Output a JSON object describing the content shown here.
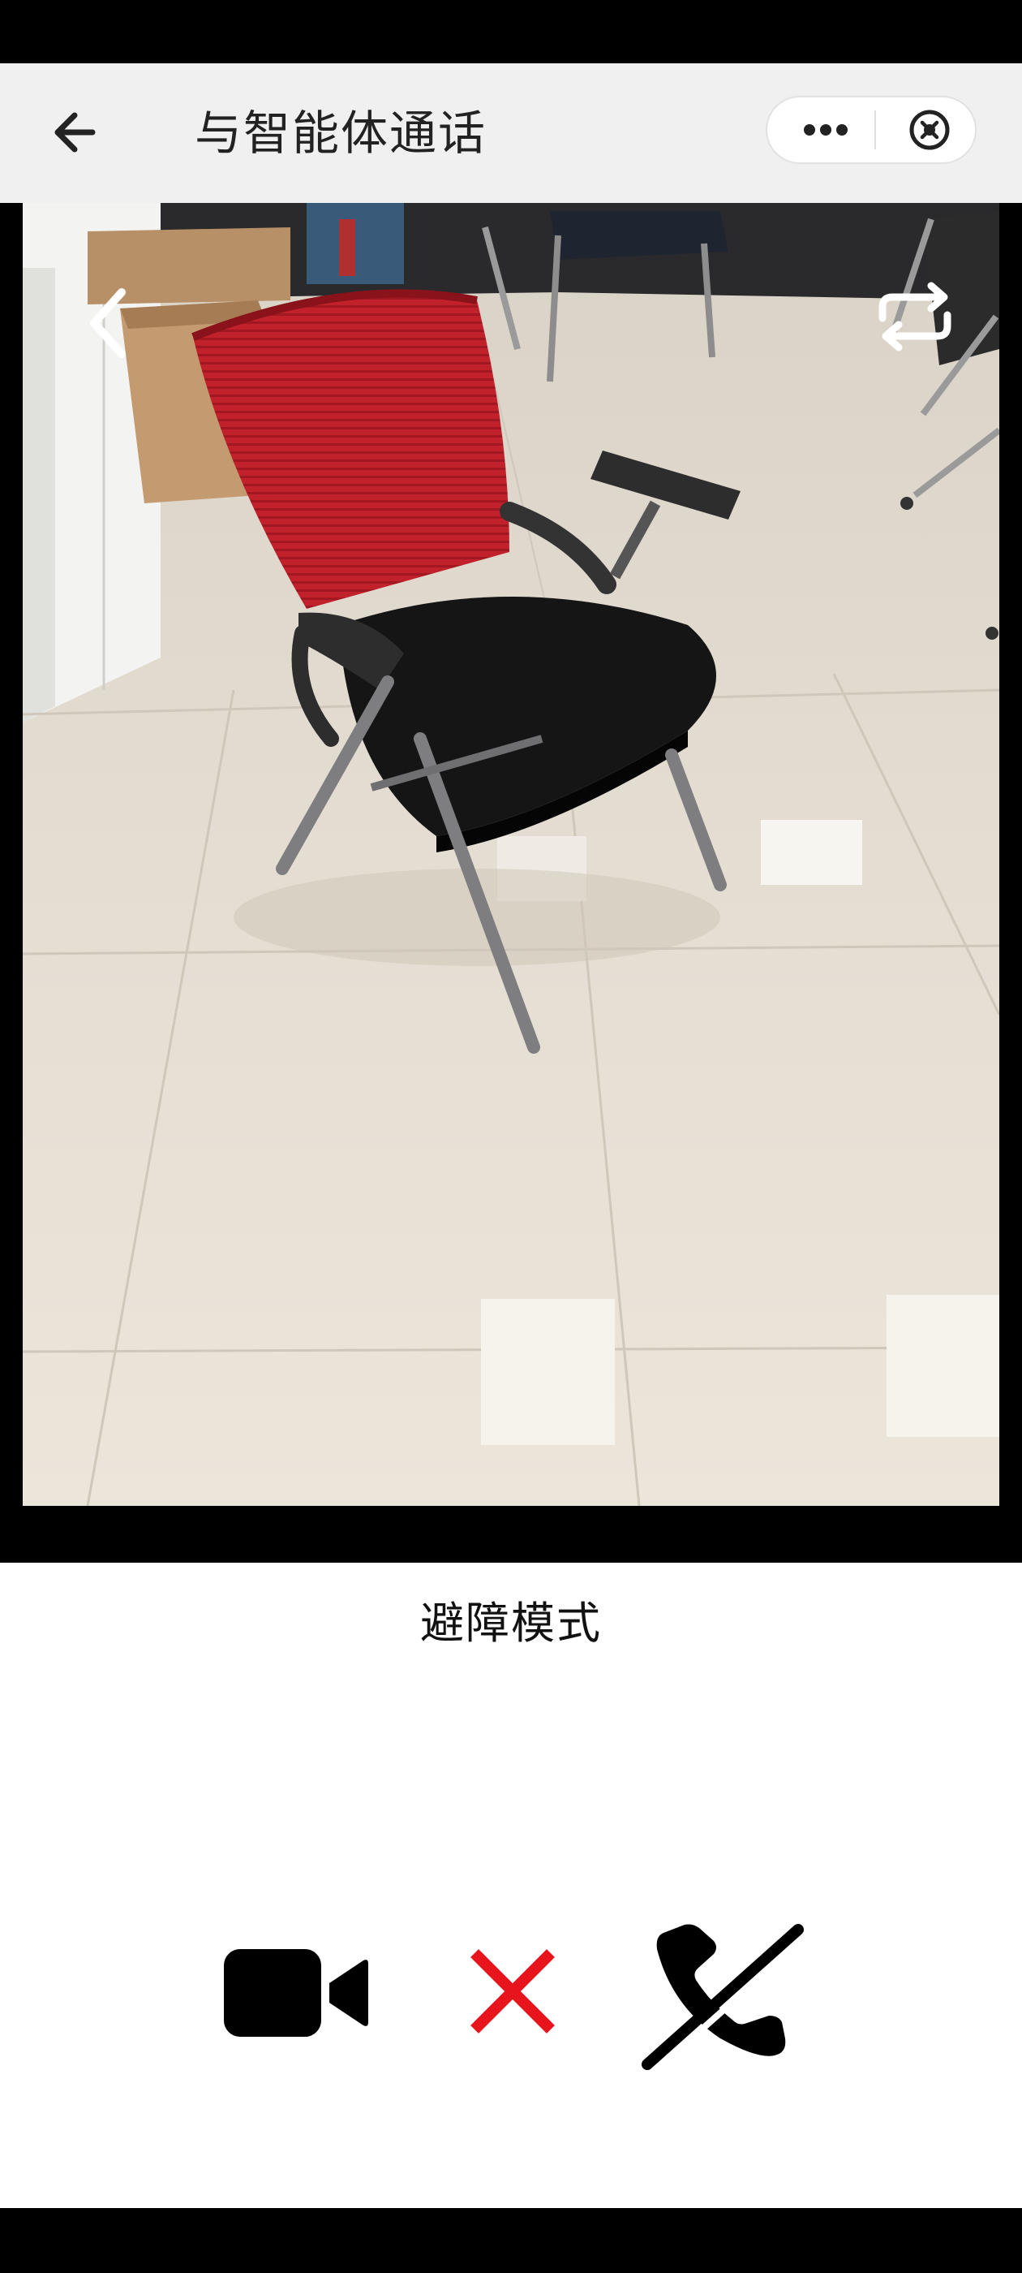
{
  "header": {
    "title": "与智能体通话",
    "back_icon": "arrow-left-icon",
    "menu_icon": "more-dots-icon",
    "close_icon": "close-circle-icon"
  },
  "video": {
    "scene": "camera-feed-chair",
    "back_icon": "chevron-left-icon",
    "switch_icon": "camera-switch-icon"
  },
  "mode": {
    "label": "避障模式"
  },
  "controls": {
    "video_icon": "video-camera-icon",
    "cancel_icon": "cancel-x-icon",
    "hangup_icon": "hang-up-icon",
    "cancel_color": "#e8141b"
  },
  "colors": {
    "title_bar": "#f0f0f0",
    "chair_mesh": "#c0212a"
  }
}
